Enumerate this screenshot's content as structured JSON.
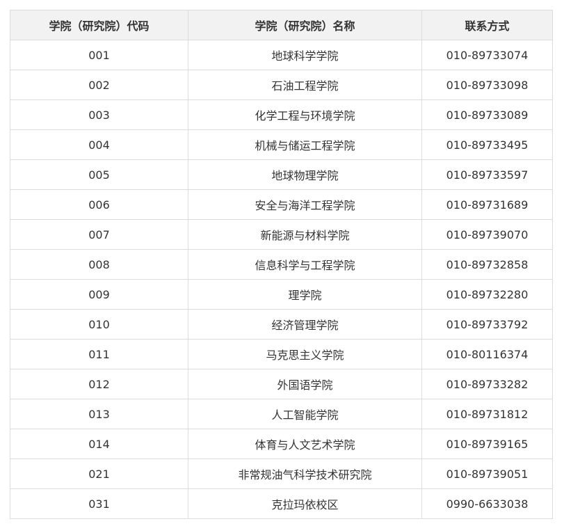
{
  "table": {
    "headers": [
      "学院（研究院）代码",
      "学院（研究院）名称",
      "联系方式"
    ],
    "rows": [
      [
        "001",
        "地球科学学院",
        "010-89733074"
      ],
      [
        "002",
        "石油工程学院",
        "010-89733098"
      ],
      [
        "003",
        "化学工程与环境学院",
        "010-89733089"
      ],
      [
        "004",
        "机械与储运工程学院",
        "010-89733495"
      ],
      [
        "005",
        "地球物理学院",
        "010-89733597"
      ],
      [
        "006",
        "安全与海洋工程学院",
        "010-89731689"
      ],
      [
        "007",
        "新能源与材料学院",
        "010-89739070"
      ],
      [
        "008",
        "信息科学与工程学院",
        "010-89732858"
      ],
      [
        "009",
        "理学院",
        "010-89732280"
      ],
      [
        "010",
        "经济管理学院",
        "010-89733792"
      ],
      [
        "011",
        "马克思主义学院",
        "010-80116374"
      ],
      [
        "012",
        "外国语学院",
        "010-89733282"
      ],
      [
        "013",
        "人工智能学院",
        "010-89731812"
      ],
      [
        "014",
        "体育与人文艺术学院",
        "010-89739165"
      ],
      [
        "021",
        "非常规油气科学技术研究院",
        "010-89739051"
      ],
      [
        "031",
        "克拉玛依校区",
        "0990-6633038"
      ]
    ]
  }
}
